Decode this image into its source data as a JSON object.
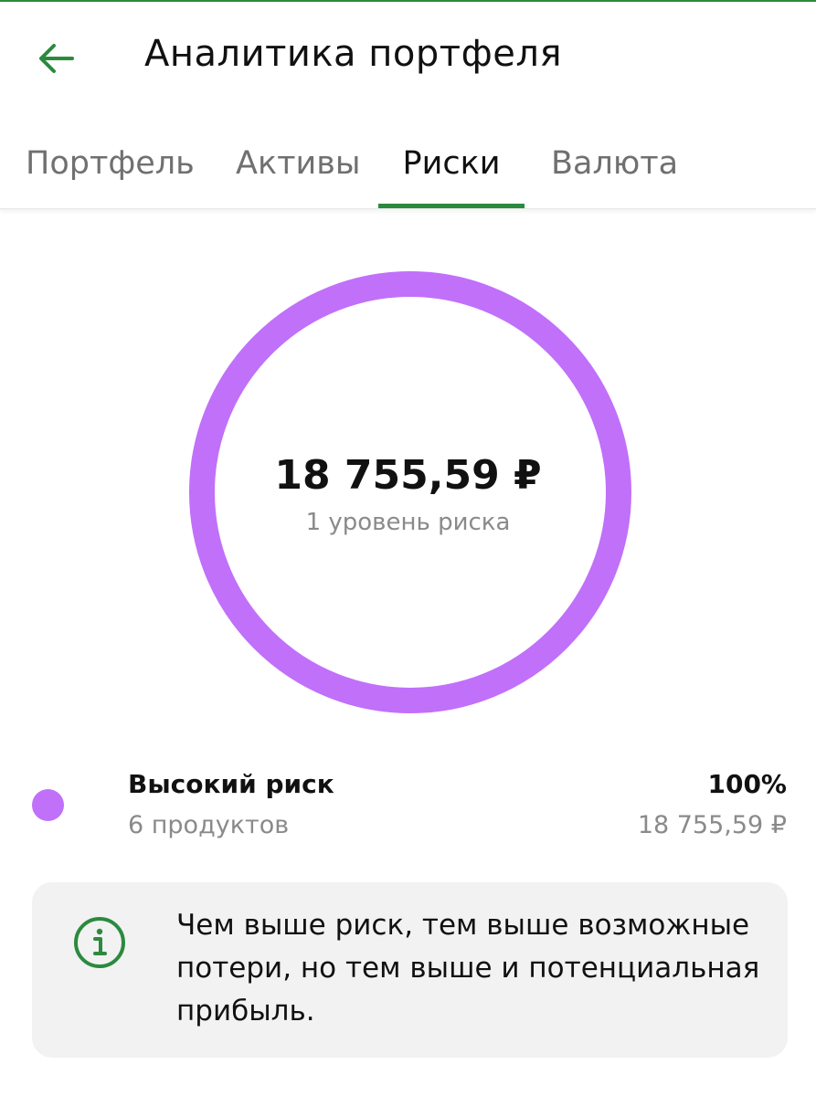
{
  "header": {
    "title": "Аналитика портфеля",
    "back_icon": "arrow-left-icon"
  },
  "tabs": [
    {
      "label": "Портфель",
      "active": false
    },
    {
      "label": "Активы",
      "active": false
    },
    {
      "label": "Риски",
      "active": true
    },
    {
      "label": "Валюта",
      "active": false
    }
  ],
  "chart_data": {
    "type": "pie",
    "categories": [
      "Высокий риск"
    ],
    "values": [
      100
    ],
    "colors": [
      "#c170fa"
    ],
    "center_value": "18 755,59 ₽",
    "center_label": "1 уровень риска"
  },
  "legend": [
    {
      "name": "Высокий риск",
      "count": "6 продуктов",
      "percent": "100%",
      "amount": "18 755,59 ₽",
      "color": "#c170fa"
    }
  ],
  "info": {
    "icon": "info-icon",
    "text": "Чем выше риск, тем выше возможные потери, но тем выше и потенциальная прибыль."
  },
  "colors": {
    "accent": "#2b8a3e",
    "risk_high": "#c170fa"
  }
}
